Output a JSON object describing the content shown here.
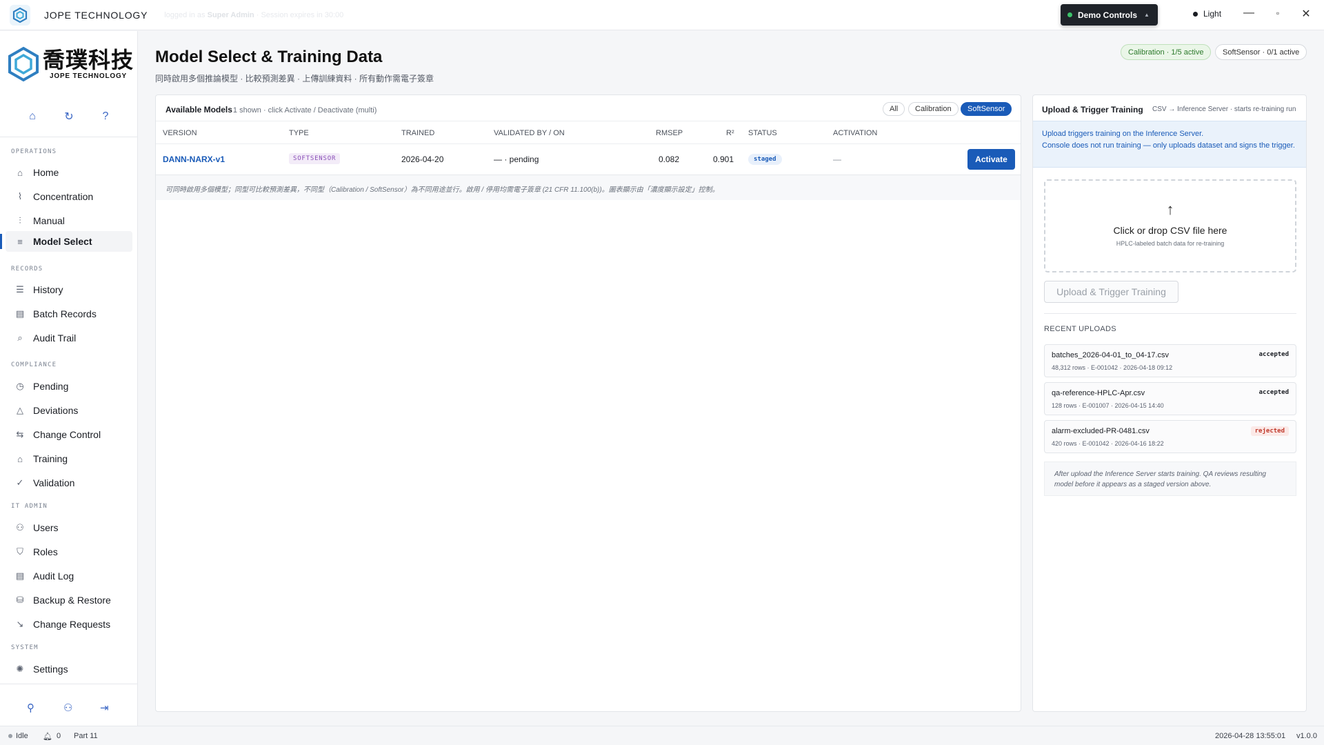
{
  "app": {
    "brand": "JOPE TECHNOLOGY",
    "logged_in_prefix": "logged in as",
    "logged_in_role": "Super Admin",
    "session_info": "· Session expires in 30:00",
    "demo_controls": "Demo Controls",
    "theme": "Light"
  },
  "logo": {
    "cn": "喬璞科技",
    "en": "JOPE TECHNOLOGY"
  },
  "sidebar": {
    "sections": {
      "operations": "OPERATIONS",
      "records": "RECORDS",
      "compliance": "COMPLIANCE",
      "it_admin": "IT ADMIN",
      "system": "SYSTEM"
    },
    "items": {
      "home": "Home",
      "concentration": "Concentration",
      "manual": "Manual",
      "model_select": "Model Select",
      "history": "History",
      "batch_records": "Batch Records",
      "audit_trail": "Audit Trail",
      "pending": "Pending",
      "deviations": "Deviations",
      "change_control": "Change Control",
      "training": "Training",
      "validation": "Validation",
      "users": "Users",
      "roles": "Roles",
      "audit_log": "Audit Log",
      "backup_restore": "Backup & Restore",
      "change_requests": "Change Requests",
      "settings": "Settings"
    },
    "active": "Model Select"
  },
  "page": {
    "title": "Model Select & Training Data",
    "subtitle": "同時啟用多個推論模型 · 比較預測差異 · 上傳訓練資料 · 所有動作需電子簽章",
    "badges": {
      "calibration": "Calibration · 1/5 active",
      "softsensor": "SoftSensor · 0/1 active"
    }
  },
  "models": {
    "title": "Available Models",
    "subtitle": "1 shown · click Activate / Deactivate (multi)",
    "filters": [
      "All",
      "Calibration",
      "SoftSensor"
    ],
    "active_filter": "SoftSensor",
    "columns": {
      "version": "VERSION",
      "type": "TYPE",
      "trained": "TRAINED",
      "validated": "VALIDATED BY / ON",
      "rmsep": "RMSEP",
      "r2": "R²",
      "status": "STATUS",
      "activation": "ACTIVATION"
    },
    "rows": [
      {
        "version": "DANN-NARX-v1",
        "type": "SOFTSENSOR",
        "trained": "2026-04-20",
        "validated": "— · pending",
        "rmsep": "0.082",
        "r2": "0.901",
        "status": "staged",
        "activation": "—",
        "action": "Activate"
      }
    ],
    "footnote": "可同時啟用多個模型；同型可比較預測差異，不同型（Calibration / SoftSensor）為不同用途並行。啟用 / 停用均需電子簽章 (21 CFR 11.100(b))。圖表顯示由「濃度顯示設定」控制。"
  },
  "upload": {
    "title": "Upload & Trigger Training",
    "hint": "CSV → Inference Server · starts re-training run",
    "info_line1": "Upload triggers training on the Inference Server.",
    "info_line2": "Console does not run training — only uploads dataset and signs the trigger.",
    "drop_title": "Click or drop CSV file here",
    "drop_sub": "HPLC-labeled batch data for re-training",
    "trigger_button": "Upload & Trigger Training",
    "recent_title": "RECENT UPLOADS",
    "files": [
      {
        "name": "batches_2026-04-01_to_04-17.csv",
        "meta": "48,312 rows · E-001042 · 2026-04-18 09:12",
        "status": "accepted"
      },
      {
        "name": "qa-reference-HPLC-Apr.csv",
        "meta": "128 rows · E-001007 · 2026-04-15 14:40",
        "status": "accepted"
      },
      {
        "name": "alarm-excluded-PR-0481.csv",
        "meta": "420 rows · E-001042 · 2026-04-16 18:22",
        "status": "rejected"
      }
    ],
    "note": "After upload the Inference Server starts training. QA reviews resulting model before it appears as a staged version above."
  },
  "status": {
    "state": "Idle",
    "notifications": "0",
    "part": "Part 11",
    "datetime": "2026-04-28 13:55:01",
    "version": "v1.0.0"
  },
  "colors": {
    "accent": "#1a5bb8",
    "sidebar_bg": "#ffffff",
    "page_bg": "#f5f6f8",
    "success": "#2d7a2d",
    "danger": "#c0392b"
  }
}
